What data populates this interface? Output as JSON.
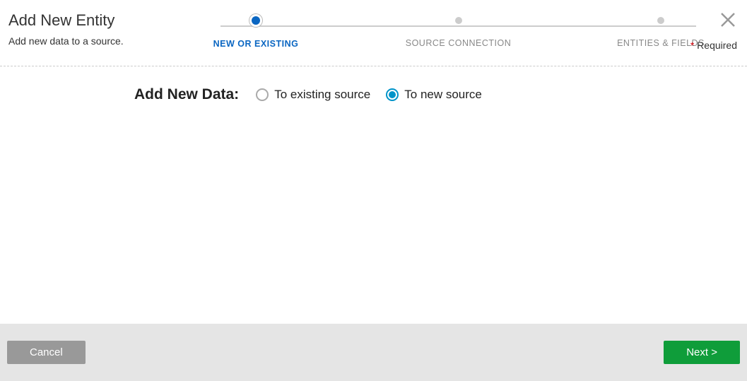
{
  "header": {
    "title": "Add New Entity",
    "subtitle": "Add new data to a source.",
    "required_label": "Required"
  },
  "stepper": {
    "steps": [
      {
        "label": "NEW OR EXISTING",
        "active": true
      },
      {
        "label": "SOURCE CONNECTION",
        "active": false
      },
      {
        "label": "ENTITIES & FIELDS",
        "active": false
      }
    ]
  },
  "content": {
    "section_label": "Add New Data:",
    "options": [
      {
        "label": "To existing source",
        "selected": false
      },
      {
        "label": "To new source",
        "selected": true
      }
    ]
  },
  "footer": {
    "cancel_label": "Cancel",
    "next_label": "Next >"
  }
}
